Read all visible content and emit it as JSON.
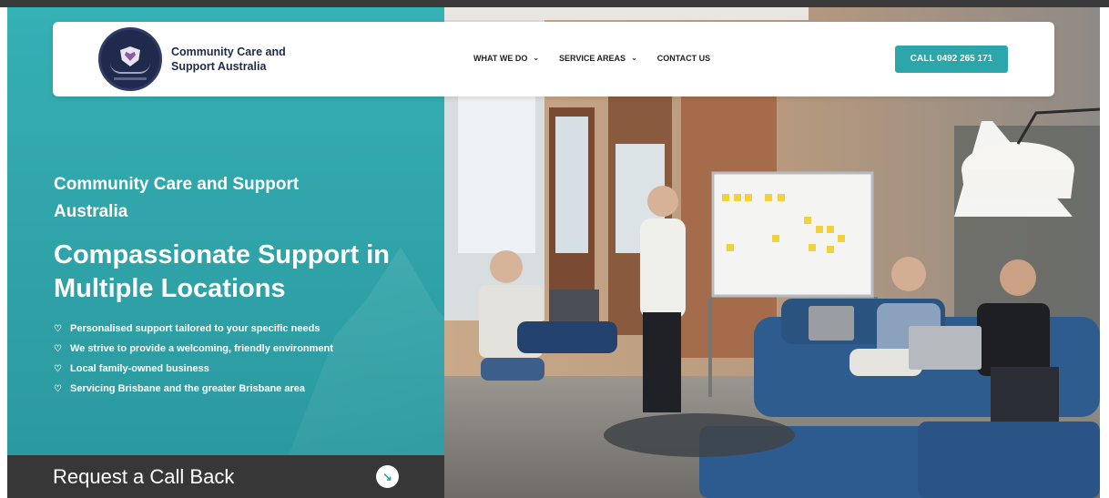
{
  "brand": {
    "name_line1": "Community Care and",
    "name_line2": "Support Australia",
    "logo_icon": "shield-heart-icon"
  },
  "nav": {
    "items": [
      {
        "label": "WHAT WE DO",
        "has_dropdown": true
      },
      {
        "label": "SERVICE AREAS",
        "has_dropdown": true
      },
      {
        "label": "CONTACT US",
        "has_dropdown": false
      }
    ],
    "call_label": "CALL 0492 265 171"
  },
  "hero": {
    "subtitle": "Community Care and Support Australia",
    "title": "Compassionate Support in Multiple Locations",
    "bullets": [
      "Personalised support tailored to your specific needs",
      "We strive to provide a welcoming, friendly environment",
      "Local family-owned business",
      "Servicing Brisbane and the greater Brisbane area"
    ],
    "bullet_icon": "handshake-icon"
  },
  "callback": {
    "label": "Request a Call Back",
    "icon": "arrow-down-right-icon"
  },
  "colors": {
    "teal": "#2fa3a8",
    "navy": "#1f2a4d",
    "dark": "#373737"
  }
}
